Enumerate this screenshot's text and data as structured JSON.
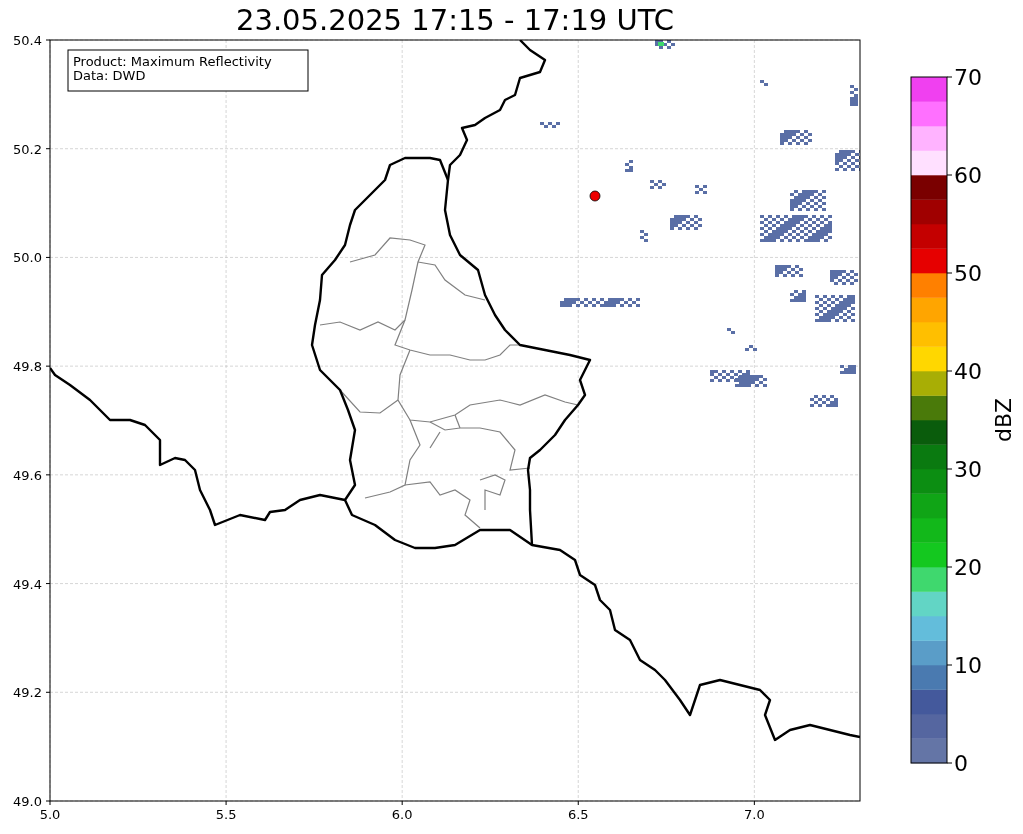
{
  "title": "23.05.2025 17:15 - 17:19 UTC",
  "info_box": [
    "Product: Maximum Reflectivity",
    "Data: DWD"
  ],
  "x_tick_labels": [
    "5.0",
    "5.5",
    "6.0",
    "6.5",
    "7.0"
  ],
  "y_tick_labels": [
    "50.4",
    "50.2",
    "50.0",
    "49.8",
    "49.6",
    "49.4",
    "49.2",
    "49.0"
  ],
  "colorbar": {
    "label": "dBZ",
    "tick_labels": [
      "70",
      "60",
      "50",
      "40",
      "30",
      "20",
      "10",
      "0"
    ],
    "bands": [
      {
        "color": "#6475a6"
      },
      {
        "color": "#5566a0"
      },
      {
        "color": "#44599c"
      },
      {
        "color": "#4a7ab0"
      },
      {
        "color": "#5a9dc8"
      },
      {
        "color": "#63bddb"
      },
      {
        "color": "#62d5c5"
      },
      {
        "color": "#3fd86e"
      },
      {
        "color": "#14c81f"
      },
      {
        "color": "#12b81a"
      },
      {
        "color": "#10a516"
      },
      {
        "color": "#0c8e12"
      },
      {
        "color": "#0a7a10"
      },
      {
        "color": "#0a5c0c"
      },
      {
        "color": "#4a7a0a"
      },
      {
        "color": "#a8ae05"
      },
      {
        "color": "#ffd700"
      },
      {
        "color": "#ffbf00"
      },
      {
        "color": "#ffa500"
      },
      {
        "color": "#ff8000"
      },
      {
        "color": "#e60000"
      },
      {
        "color": "#c40000"
      },
      {
        "color": "#a00000"
      },
      {
        "color": "#7a0000"
      },
      {
        "color": "#ffe0ff"
      },
      {
        "color": "#ffb3ff"
      },
      {
        "color": "#ff70ff"
      },
      {
        "color": "#f040f0"
      }
    ]
  }
}
